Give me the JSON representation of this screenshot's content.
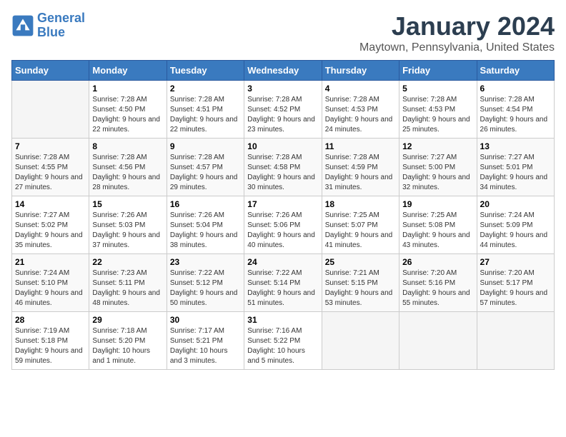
{
  "header": {
    "logo_line1": "General",
    "logo_line2": "Blue",
    "month": "January 2024",
    "location": "Maytown, Pennsylvania, United States"
  },
  "days_of_week": [
    "Sunday",
    "Monday",
    "Tuesday",
    "Wednesday",
    "Thursday",
    "Friday",
    "Saturday"
  ],
  "weeks": [
    [
      {
        "day": "",
        "sunrise": "",
        "sunset": "",
        "daylight": ""
      },
      {
        "day": "1",
        "sunrise": "7:28 AM",
        "sunset": "4:50 PM",
        "daylight": "9 hours and 22 minutes."
      },
      {
        "day": "2",
        "sunrise": "7:28 AM",
        "sunset": "4:51 PM",
        "daylight": "9 hours and 22 minutes."
      },
      {
        "day": "3",
        "sunrise": "7:28 AM",
        "sunset": "4:52 PM",
        "daylight": "9 hours and 23 minutes."
      },
      {
        "day": "4",
        "sunrise": "7:28 AM",
        "sunset": "4:53 PM",
        "daylight": "9 hours and 24 minutes."
      },
      {
        "day": "5",
        "sunrise": "7:28 AM",
        "sunset": "4:53 PM",
        "daylight": "9 hours and 25 minutes."
      },
      {
        "day": "6",
        "sunrise": "7:28 AM",
        "sunset": "4:54 PM",
        "daylight": "9 hours and 26 minutes."
      }
    ],
    [
      {
        "day": "7",
        "sunrise": "7:28 AM",
        "sunset": "4:55 PM",
        "daylight": "9 hours and 27 minutes."
      },
      {
        "day": "8",
        "sunrise": "7:28 AM",
        "sunset": "4:56 PM",
        "daylight": "9 hours and 28 minutes."
      },
      {
        "day": "9",
        "sunrise": "7:28 AM",
        "sunset": "4:57 PM",
        "daylight": "9 hours and 29 minutes."
      },
      {
        "day": "10",
        "sunrise": "7:28 AM",
        "sunset": "4:58 PM",
        "daylight": "9 hours and 30 minutes."
      },
      {
        "day": "11",
        "sunrise": "7:28 AM",
        "sunset": "4:59 PM",
        "daylight": "9 hours and 31 minutes."
      },
      {
        "day": "12",
        "sunrise": "7:27 AM",
        "sunset": "5:00 PM",
        "daylight": "9 hours and 32 minutes."
      },
      {
        "day": "13",
        "sunrise": "7:27 AM",
        "sunset": "5:01 PM",
        "daylight": "9 hours and 34 minutes."
      }
    ],
    [
      {
        "day": "14",
        "sunrise": "7:27 AM",
        "sunset": "5:02 PM",
        "daylight": "9 hours and 35 minutes."
      },
      {
        "day": "15",
        "sunrise": "7:26 AM",
        "sunset": "5:03 PM",
        "daylight": "9 hours and 37 minutes."
      },
      {
        "day": "16",
        "sunrise": "7:26 AM",
        "sunset": "5:04 PM",
        "daylight": "9 hours and 38 minutes."
      },
      {
        "day": "17",
        "sunrise": "7:26 AM",
        "sunset": "5:06 PM",
        "daylight": "9 hours and 40 minutes."
      },
      {
        "day": "18",
        "sunrise": "7:25 AM",
        "sunset": "5:07 PM",
        "daylight": "9 hours and 41 minutes."
      },
      {
        "day": "19",
        "sunrise": "7:25 AM",
        "sunset": "5:08 PM",
        "daylight": "9 hours and 43 minutes."
      },
      {
        "day": "20",
        "sunrise": "7:24 AM",
        "sunset": "5:09 PM",
        "daylight": "9 hours and 44 minutes."
      }
    ],
    [
      {
        "day": "21",
        "sunrise": "7:24 AM",
        "sunset": "5:10 PM",
        "daylight": "9 hours and 46 minutes."
      },
      {
        "day": "22",
        "sunrise": "7:23 AM",
        "sunset": "5:11 PM",
        "daylight": "9 hours and 48 minutes."
      },
      {
        "day": "23",
        "sunrise": "7:22 AM",
        "sunset": "5:12 PM",
        "daylight": "9 hours and 50 minutes."
      },
      {
        "day": "24",
        "sunrise": "7:22 AM",
        "sunset": "5:14 PM",
        "daylight": "9 hours and 51 minutes."
      },
      {
        "day": "25",
        "sunrise": "7:21 AM",
        "sunset": "5:15 PM",
        "daylight": "9 hours and 53 minutes."
      },
      {
        "day": "26",
        "sunrise": "7:20 AM",
        "sunset": "5:16 PM",
        "daylight": "9 hours and 55 minutes."
      },
      {
        "day": "27",
        "sunrise": "7:20 AM",
        "sunset": "5:17 PM",
        "daylight": "9 hours and 57 minutes."
      }
    ],
    [
      {
        "day": "28",
        "sunrise": "7:19 AM",
        "sunset": "5:18 PM",
        "daylight": "9 hours and 59 minutes."
      },
      {
        "day": "29",
        "sunrise": "7:18 AM",
        "sunset": "5:20 PM",
        "daylight": "10 hours and 1 minute."
      },
      {
        "day": "30",
        "sunrise": "7:17 AM",
        "sunset": "5:21 PM",
        "daylight": "10 hours and 3 minutes."
      },
      {
        "day": "31",
        "sunrise": "7:16 AM",
        "sunset": "5:22 PM",
        "daylight": "10 hours and 5 minutes."
      },
      {
        "day": "",
        "sunrise": "",
        "sunset": "",
        "daylight": ""
      },
      {
        "day": "",
        "sunrise": "",
        "sunset": "",
        "daylight": ""
      },
      {
        "day": "",
        "sunrise": "",
        "sunset": "",
        "daylight": ""
      }
    ]
  ],
  "labels": {
    "sunrise": "Sunrise:",
    "sunset": "Sunset:",
    "daylight": "Daylight:"
  }
}
